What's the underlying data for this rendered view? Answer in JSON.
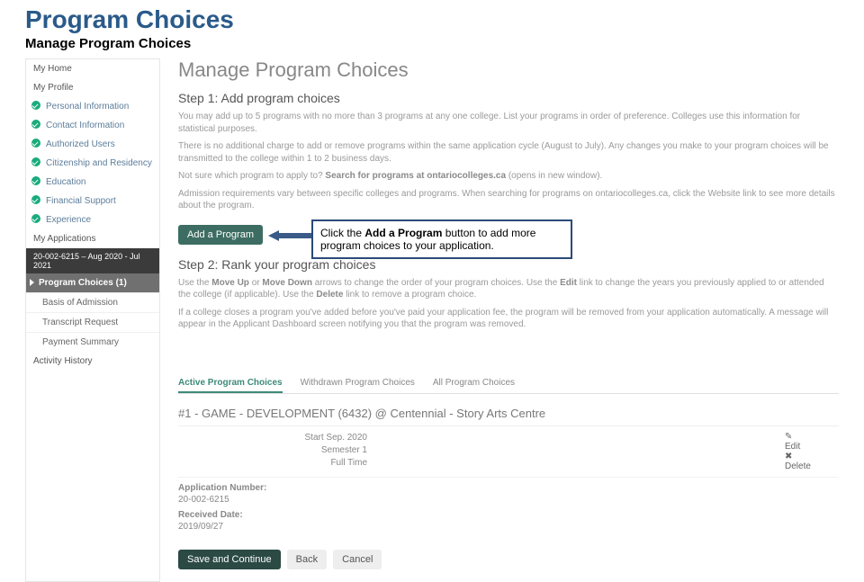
{
  "page": {
    "title": "Program Choices",
    "subtitle": "Manage Program Choices"
  },
  "sidebar": {
    "home": "My Home",
    "profile": "My Profile",
    "checks": [
      "Personal Information",
      "Contact Information",
      "Authorized Users",
      "Citizenship and Residency",
      "Education",
      "Financial Support",
      "Experience"
    ],
    "apps_header": "My Applications",
    "app_id": "20-002-6215 – Aug 2020 - Jul 2021",
    "active": "Program Choices (1)",
    "subs": [
      "Basis of Admission",
      "Transcript Request",
      "Payment Summary"
    ],
    "activity": "Activity History"
  },
  "main": {
    "heading": "Manage Program Choices",
    "step1": "Step 1: Add program choices",
    "p1": "You may add up to 5 programs with no more than 3 programs at any one college. List your programs in order of preference. Colleges use this information for statistical purposes.",
    "p2": "There is no additional charge to add or remove programs within the same application cycle (August to July). Any changes you make to your program choices will be transmitted to the college within 1 to 2 business days.",
    "p3a": "Not sure which program to apply to? ",
    "p3b": "Search for programs at ontariocolleges.ca",
    "p3c": " (opens in new window).",
    "p4": "Admission requirements vary between specific colleges and programs. When searching for programs on ontariocolleges.ca, click the Website link to see more details about the program.",
    "add_btn": "Add a Program",
    "callout_a": "Click the ",
    "callout_b": "Add a Program",
    "callout_c": " button to add more program choices to your application.",
    "step2": "Step 2: Rank your program choices",
    "p5a": "Use the ",
    "p5b": "Move Up",
    "p5c": " or ",
    "p5d": "Move Down",
    "p5e": " arrows to change the order of your program choices. Use the ",
    "p5f": "Edit",
    "p5g": " link to change the years you previously applied to or attended the college (if applicable). Use the ",
    "p5h": "Delete",
    "p5i": " link to remove a program choice.",
    "p6": "If a college closes a program you've added before you've paid your application fee, the program will be removed from your application automatically. A message will appear in the Applicant Dashboard screen notifying you that the program was removed.",
    "tabs": [
      "Active Program Choices",
      "Withdrawn Program Choices",
      "All Program Choices"
    ],
    "choice": {
      "title": "#1 - GAME - DEVELOPMENT (6432) @ Centennial - Story Arts Centre",
      "start": "Start Sep. 2020",
      "sem": "Semester 1",
      "time": "Full Time",
      "edit": "Edit",
      "delete": "Delete"
    },
    "appnum_k": "Application Number:",
    "appnum_v": "20-002-6215",
    "recv_k": "Received Date:",
    "recv_v": "2019/09/27",
    "save": "Save and Continue",
    "back": "Back",
    "cancel": "Cancel"
  }
}
